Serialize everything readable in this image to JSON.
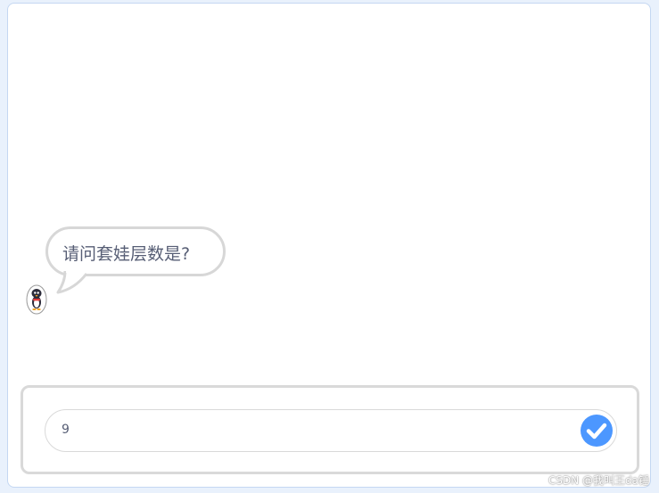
{
  "stage": {
    "speech_bubble": {
      "text": "请问套娃层数是?"
    },
    "sprite": {
      "icon": "penguin-sprite-icon"
    }
  },
  "ask_prompt": {
    "input_value": "9",
    "submit_icon": "checkmark-icon",
    "accent_color": "#4c97ff"
  },
  "watermark": {
    "text": "CSDN @我叫王da锤"
  }
}
